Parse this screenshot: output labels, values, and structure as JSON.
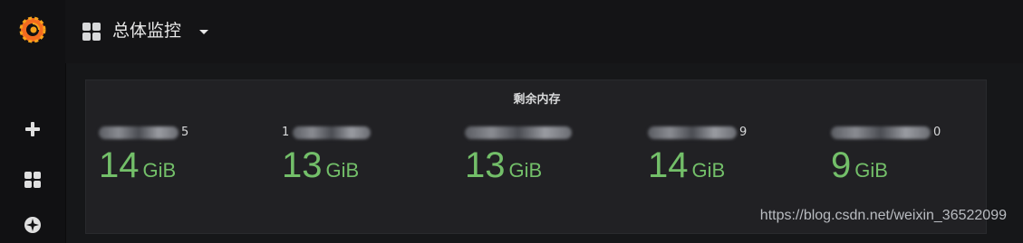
{
  "sidebar": {
    "items": [
      {
        "name": "create",
        "icon": "plus-icon"
      },
      {
        "name": "dashboards",
        "icon": "grid-icon"
      },
      {
        "name": "explore",
        "icon": "compass-icon"
      }
    ]
  },
  "header": {
    "title": "总体监控",
    "icon": "dashboard-grid-icon"
  },
  "panel": {
    "title": "剩余内存",
    "stats": [
      {
        "name_tail": "5",
        "value": "14",
        "unit": "GiB"
      },
      {
        "name_prefix": "1",
        "name_tail": "",
        "value": "13",
        "unit": "GiB"
      },
      {
        "name_tail": "",
        "value": "13",
        "unit": "GiB"
      },
      {
        "name_tail": "9",
        "value": "14",
        "unit": "GiB"
      },
      {
        "name_tail": "0",
        "value": "9",
        "unit": "GiB"
      }
    ],
    "value_color": "#73bf69"
  },
  "watermark": "https://blog.csdn.net/weixin_36522099"
}
